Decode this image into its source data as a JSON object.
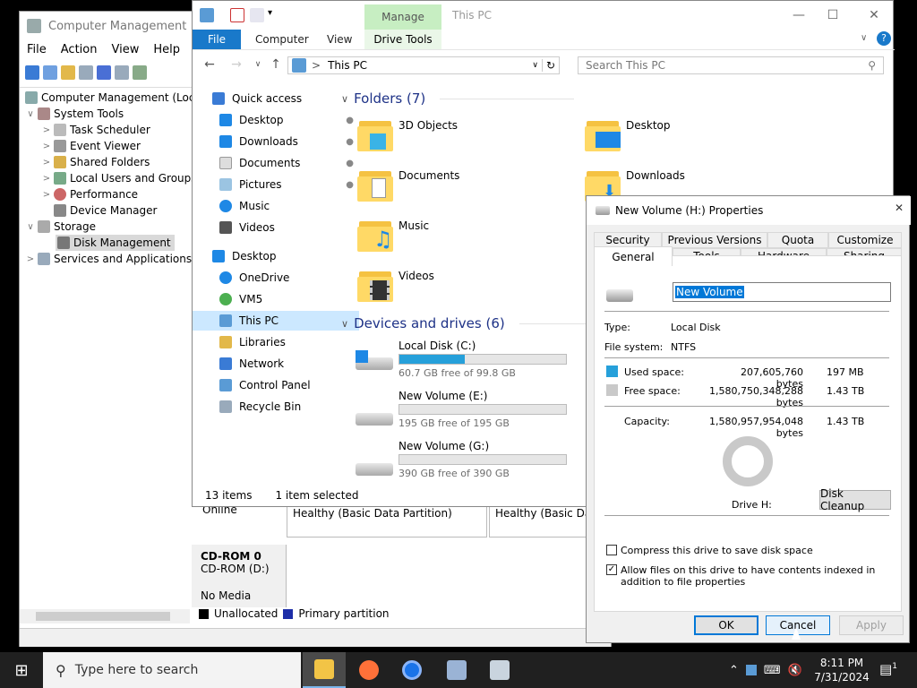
{
  "computer_management": {
    "title": "Computer Management",
    "menu": [
      "File",
      "Action",
      "View",
      "Help"
    ],
    "tree": [
      {
        "label": "Computer Management (Local",
        "icon": "computer-icon"
      },
      {
        "label": "System Tools",
        "icon": "tools-icon"
      },
      {
        "label": "Task Scheduler",
        "icon": "clock-icon"
      },
      {
        "label": "Event Viewer",
        "icon": "event-viewer-icon"
      },
      {
        "label": "Shared Folders",
        "icon": "shared-folder-icon"
      },
      {
        "label": "Local Users and Groups",
        "icon": "users-icon"
      },
      {
        "label": "Performance",
        "icon": "performance-icon"
      },
      {
        "label": "Device Manager",
        "icon": "device-manager-icon"
      },
      {
        "label": "Storage",
        "icon": "storage-icon"
      },
      {
        "label": "Disk Management",
        "icon": "disk-icon",
        "selected": true
      },
      {
        "label": "Services and Applications",
        "icon": "services-icon"
      }
    ],
    "disk_panel": {
      "online": "Online",
      "partition1": "Healthy (Basic Data Partition)",
      "partition2": "Healthy (Basic Data",
      "cdrom_title": "CD-ROM 0",
      "cdrom_drive": "CD-ROM (D:)",
      "cdrom_media": "No Media",
      "legend_unallocated": "Unallocated",
      "legend_primary": "Primary partition"
    }
  },
  "explorer": {
    "title": "This PC",
    "manage_tab": "Manage",
    "ribbon_tabs": [
      "File",
      "Computer",
      "View",
      "Drive Tools"
    ],
    "address": "This PC",
    "search_placeholder": "Search This PC",
    "nav": [
      {
        "label": "Quick access",
        "icon": "star-icon",
        "pinned": false
      },
      {
        "label": "Desktop",
        "icon": "desktop-icon",
        "pinned": true
      },
      {
        "label": "Downloads",
        "icon": "download-icon",
        "pinned": true
      },
      {
        "label": "Documents",
        "icon": "documents-icon",
        "pinned": true
      },
      {
        "label": "Pictures",
        "icon": "pictures-icon",
        "pinned": true
      },
      {
        "label": "Music",
        "icon": "music-icon",
        "pinned": false
      },
      {
        "label": "Videos",
        "icon": "videos-icon",
        "pinned": false
      },
      {
        "label": "Desktop",
        "icon": "desktop-icon",
        "pinned": false
      },
      {
        "label": "OneDrive",
        "icon": "onedrive-icon",
        "pinned": false
      },
      {
        "label": "VM5",
        "icon": "user-icon",
        "pinned": false
      },
      {
        "label": "This PC",
        "icon": "this-pc-icon",
        "pinned": false,
        "selected": true
      },
      {
        "label": "Libraries",
        "icon": "libraries-icon",
        "pinned": false
      },
      {
        "label": "Network",
        "icon": "network-icon",
        "pinned": false
      },
      {
        "label": "Control Panel",
        "icon": "control-panel-icon",
        "pinned": false
      },
      {
        "label": "Recycle Bin",
        "icon": "recycle-bin-icon",
        "pinned": false
      }
    ],
    "folders_header": "Folders (7)",
    "folders": [
      "3D Objects",
      "Desktop",
      "Documents",
      "Downloads",
      "Music",
      "Videos"
    ],
    "drives_header": "Devices and drives (6)",
    "drives": [
      {
        "name": "Local Disk (C:)",
        "free": "60.7 GB free of 99.8 GB",
        "used_fraction": 0.39
      },
      {
        "name": "New Volume (E:)",
        "free": "195 GB free of 195 GB",
        "used_fraction": 0.0
      },
      {
        "name": "New Volume (G:)",
        "free": "390 GB free of 390 GB",
        "used_fraction": 0.0
      }
    ],
    "status_items": "13 items",
    "status_selected": "1 item selected"
  },
  "properties": {
    "title": "New Volume (H:) Properties",
    "tabs_row1": [
      "Security",
      "Previous Versions",
      "Quota",
      "Customize"
    ],
    "tabs_row2": [
      "General",
      "Tools",
      "Hardware",
      "Sharing"
    ],
    "volume_name": "New Volume",
    "type_label": "Type:",
    "type_value": "Local Disk",
    "fs_label": "File system:",
    "fs_value": "NTFS",
    "used_label": "Used space:",
    "used_bytes": "207,605,760 bytes",
    "used_size": "197 MB",
    "free_label": "Free space:",
    "free_bytes": "1,580,750,348,288 bytes",
    "free_size": "1.43 TB",
    "cap_label": "Capacity:",
    "cap_bytes": "1,580,957,954,048 bytes",
    "cap_size": "1.43 TB",
    "drive_label": "Drive H:",
    "disk_cleanup": "Disk Cleanup",
    "compress_label": "Compress this drive to save disk space",
    "compress_checked": false,
    "index_label": "Allow files on this drive to have contents indexed in addition to file properties",
    "index_checked": true,
    "ok": "OK",
    "cancel": "Cancel",
    "apply": "Apply",
    "colors": {
      "used": "#26a0da",
      "free": "#c9c9c9"
    }
  },
  "taskbar": {
    "search_placeholder": "Type here to search",
    "time": "8:11 PM",
    "date": "7/31/2024",
    "notification_count": "1"
  }
}
